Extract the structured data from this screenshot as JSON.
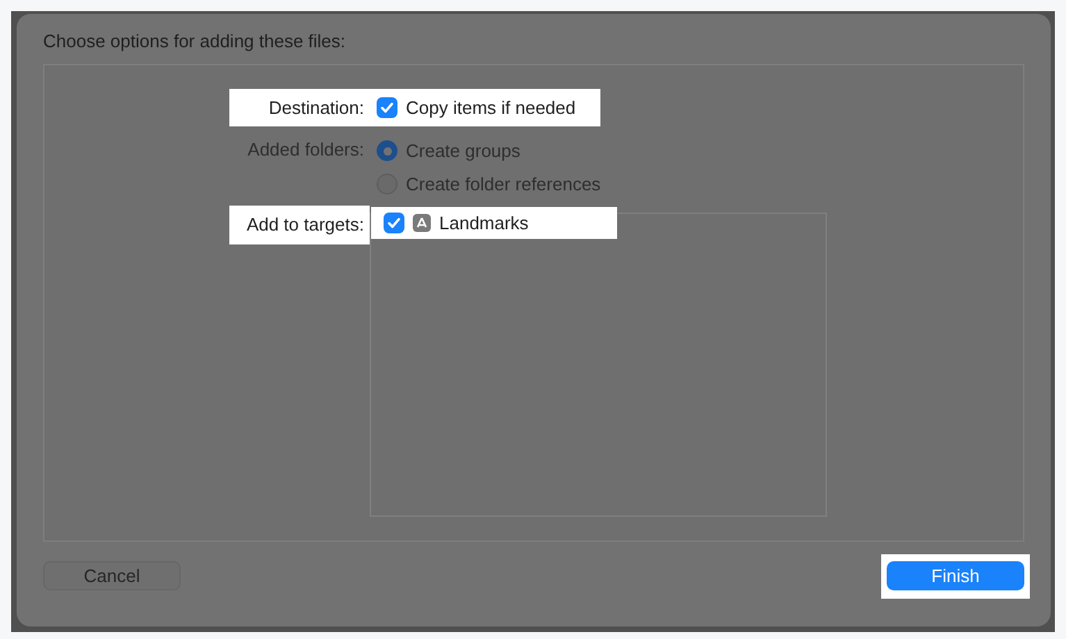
{
  "title": "Choose options for adding these files:",
  "options": [
    {
      "label": "Destination:",
      "kind": "checkbox",
      "highlighted": true,
      "items": [
        {
          "text": "Copy items if needed",
          "checked": true
        }
      ]
    },
    {
      "label": "Added folders:",
      "kind": "radio",
      "highlighted": false,
      "items": [
        {
          "text": "Create groups",
          "selected": true
        },
        {
          "text": "Create folder references",
          "selected": false
        }
      ]
    },
    {
      "label": "Add to targets:",
      "kind": "targets",
      "highlighted": true,
      "items": [
        {
          "text": "Landmarks",
          "checked": true
        }
      ]
    }
  ],
  "buttons": [
    {
      "label": "Cancel",
      "kind": "secondary",
      "highlighted": false
    },
    {
      "label": "Finish",
      "kind": "primary",
      "highlighted": true
    }
  ]
}
